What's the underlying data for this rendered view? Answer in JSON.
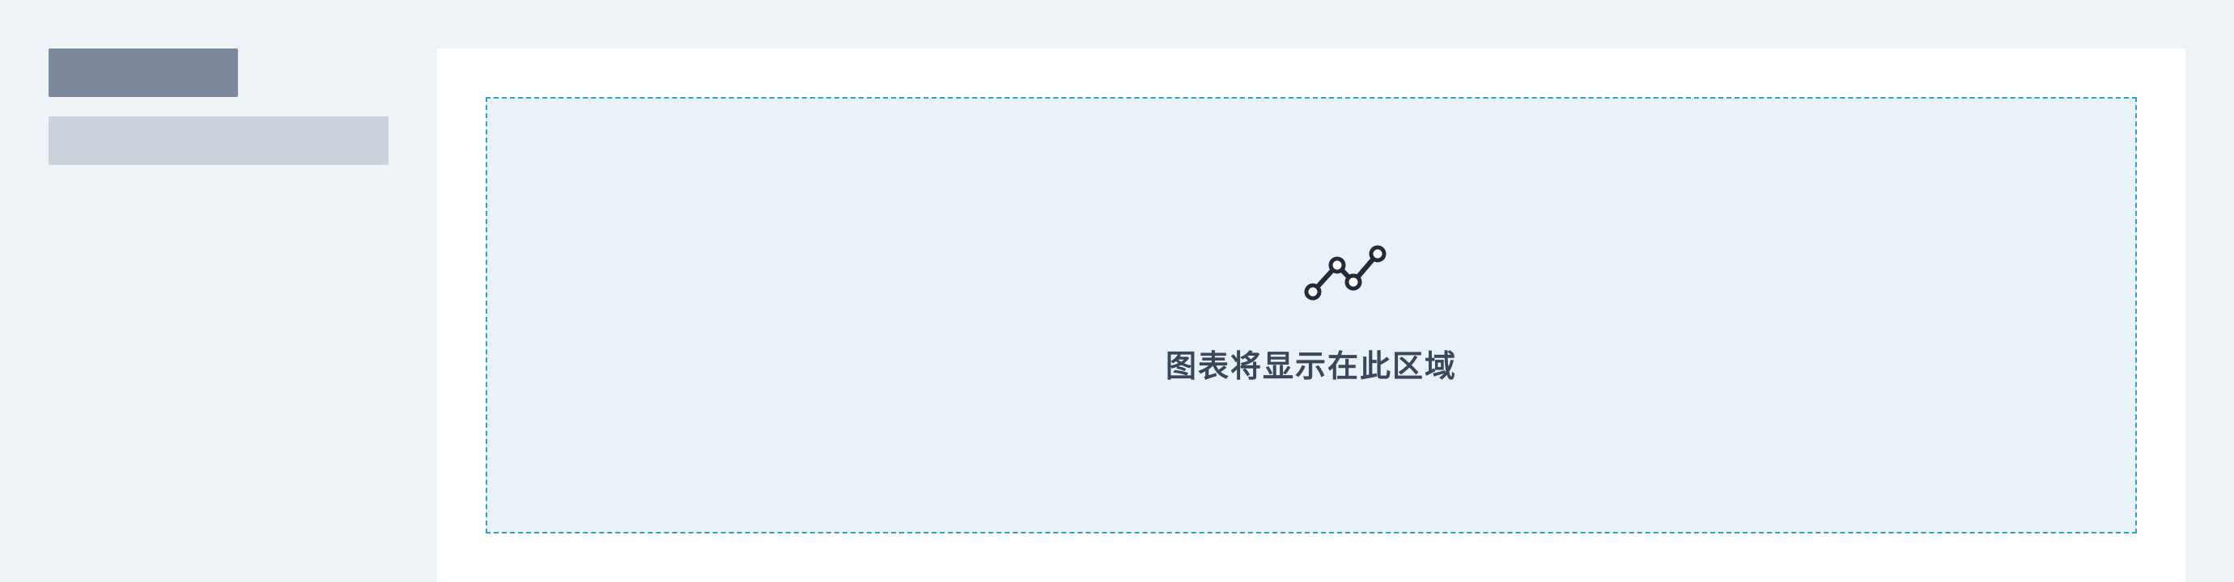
{
  "sidebar": {
    "title_skeleton": "",
    "subtitle_skeleton": ""
  },
  "main": {
    "placeholder": {
      "icon": "line-chart-icon",
      "text": "图表将显示在此区域"
    }
  },
  "colors": {
    "page_background": "#eef3f8",
    "panel_background": "#ffffff",
    "placeholder_background": "#e9f1f9",
    "placeholder_border": "#2b9fd1",
    "skeleton_dark": "#7c889e",
    "skeleton_light": "#ccd2db",
    "text": "#3a465a"
  }
}
